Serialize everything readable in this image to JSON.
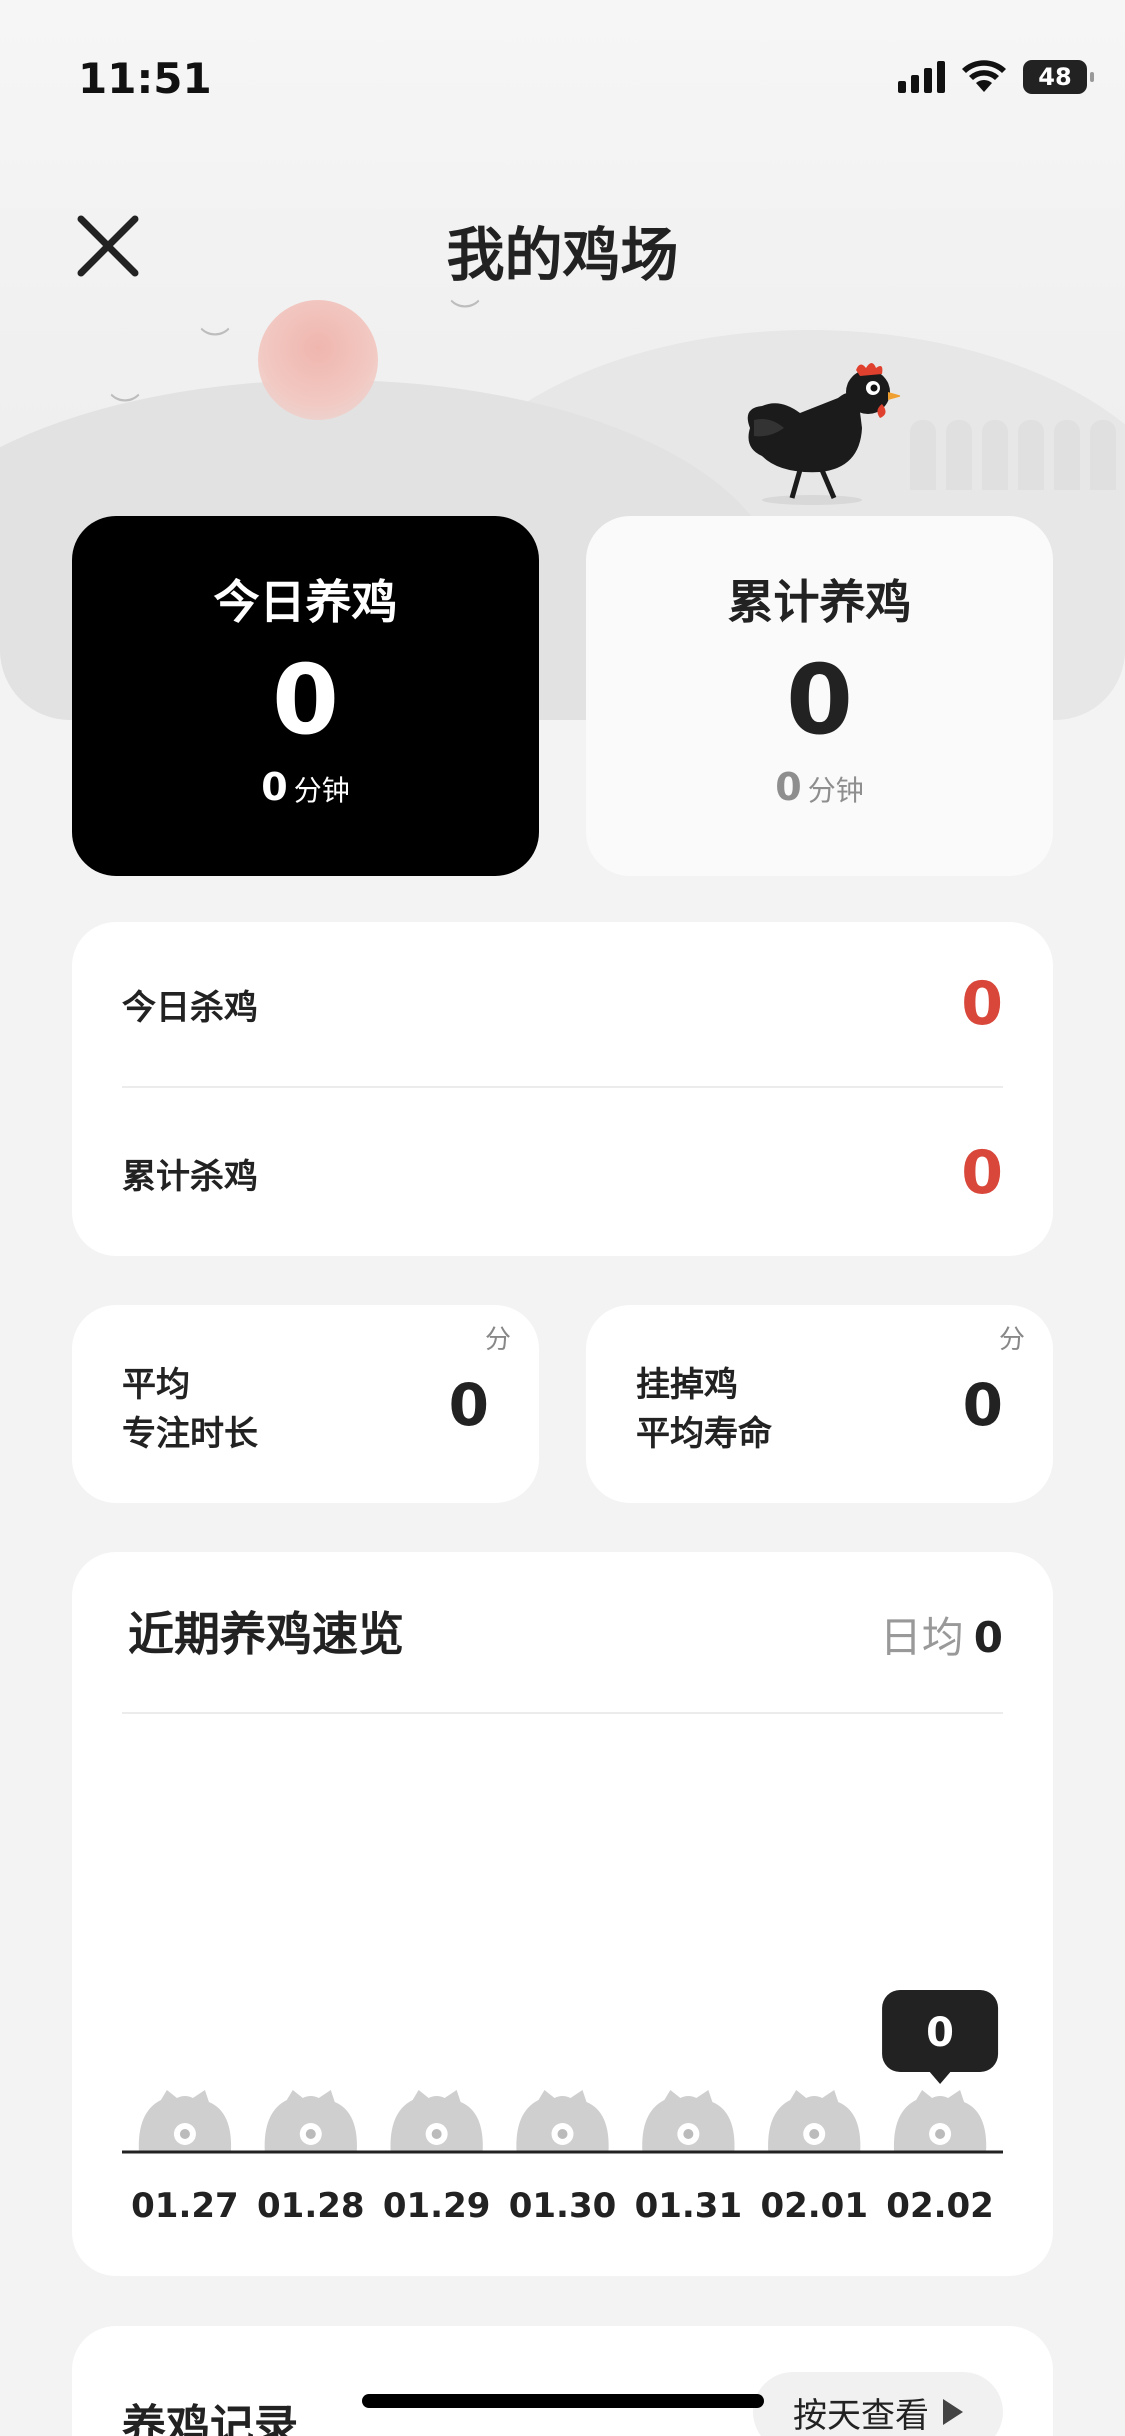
{
  "status_bar": {
    "time": "11:51",
    "battery": "48"
  },
  "header": {
    "title": "我的鸡场"
  },
  "today_card": {
    "title": "今日养鸡",
    "value": "0",
    "minutes": "0",
    "unit": "分钟"
  },
  "total_card": {
    "title": "累计养鸡",
    "value": "0",
    "minutes": "0",
    "unit": "分钟"
  },
  "kills": {
    "today_label": "今日杀鸡",
    "today_value": "0",
    "total_label": "累计杀鸡",
    "total_value": "0"
  },
  "avg_focus": {
    "label_line1": "平均",
    "label_line2": "专注时长",
    "value": "0",
    "unit": "分"
  },
  "dead_life": {
    "label_line1": "挂掉鸡",
    "label_line2": "平均寿命",
    "value": "0",
    "unit": "分"
  },
  "chart": {
    "title": "近期养鸡速览",
    "avg_label": "日均",
    "avg_value": "0",
    "tooltip": "0"
  },
  "chart_data": {
    "type": "bar",
    "title": "近期养鸡速览",
    "categories": [
      "01.27",
      "01.28",
      "01.29",
      "01.30",
      "01.31",
      "02.01",
      "02.02"
    ],
    "values": [
      0,
      0,
      0,
      0,
      0,
      0,
      0
    ],
    "highlighted": "02.02"
  },
  "records": {
    "title": "养鸡记录",
    "by_day_label": "按天查看"
  },
  "colors": {
    "accent_red": "#d9473a",
    "dark_card": "#000000"
  }
}
